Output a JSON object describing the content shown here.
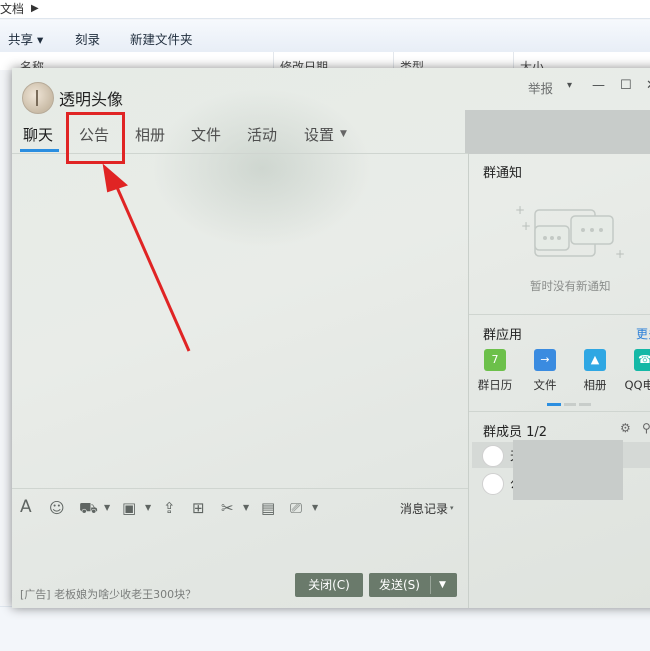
{
  "explorer": {
    "breadcrumb": "文档",
    "toolbar": {
      "share": "共享 ▾",
      "burn": "刻录",
      "new_folder": "新建文件夹"
    },
    "columns": [
      "名称",
      "修改日期",
      "类型",
      "大小"
    ]
  },
  "qq": {
    "group_name": "透明头像",
    "report": "举报",
    "report_caret": "▾",
    "window_controls": {
      "minimize": "—",
      "maximize": "☐",
      "close": "✕"
    },
    "tabs": [
      {
        "label": "聊天",
        "active": true
      },
      {
        "label": "公告",
        "active": false
      },
      {
        "label": "相册",
        "active": false
      },
      {
        "label": "文件",
        "active": false
      },
      {
        "label": "活动",
        "active": false
      },
      {
        "label": "设置",
        "active": false,
        "dropdown": true
      }
    ],
    "input_toolbar": {
      "tools": [
        "font-icon",
        "emoji-icon",
        "gift-icon",
        "image-icon",
        "upload-icon",
        "bag-icon",
        "scissors-icon",
        "archive-icon",
        "screen-icon"
      ],
      "history_label": "消息记录",
      "history_caret": "▾"
    },
    "ad_text": "[广告] 老板娘为啥少收老王300块？",
    "buttons": {
      "close": "关闭(C)",
      "send": "发送(S)",
      "send_caret": "▼"
    },
    "right_panel": {
      "notice_title": "群通知",
      "notice_empty": "暂时没有新通知",
      "apps_title": "群应用",
      "more": "更多",
      "apps": [
        {
          "label": "群日历",
          "color": "#6cc04a",
          "glyph": "7"
        },
        {
          "label": "文件",
          "color": "#3a8be0",
          "glyph": "→"
        },
        {
          "label": "相册",
          "color": "#2fa7e3",
          "glyph": "▲"
        },
        {
          "label": "QQ电话",
          "color": "#14b8a6",
          "glyph": "☎"
        }
      ],
      "members_title": "群成员 1/2",
      "members": [
        {
          "name": "天",
          "selected": true
        },
        {
          "name": "公",
          "selected": false
        }
      ]
    }
  },
  "annotation": {
    "color": "#e02424"
  }
}
